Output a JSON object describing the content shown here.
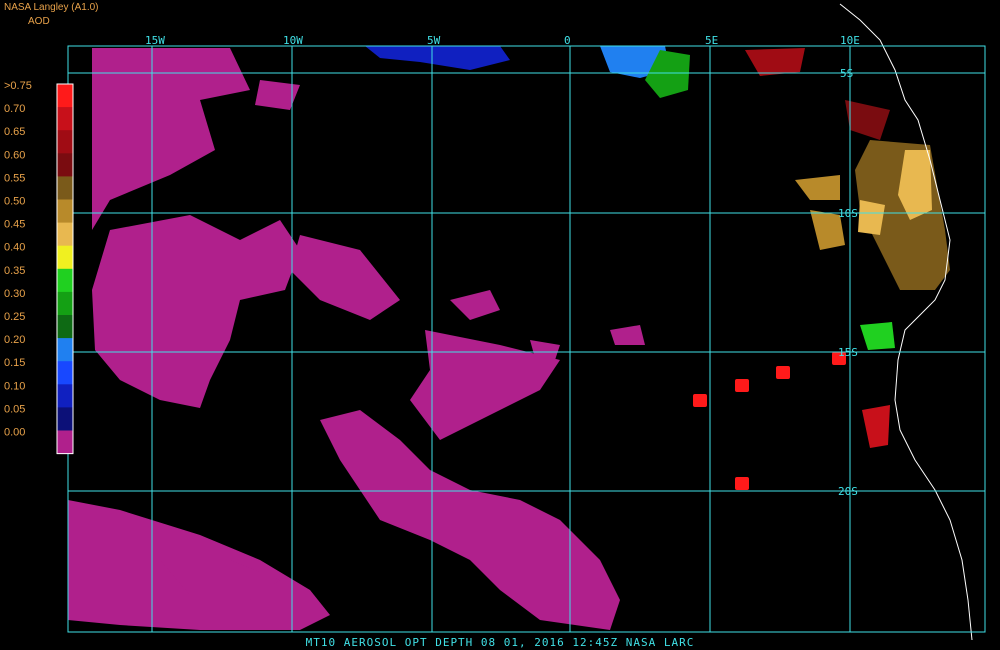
{
  "header": {
    "title": "NASA Langley (A1.0)",
    "unit": "AOD"
  },
  "legend": {
    "labels": [
      ">0.75",
      "0.70",
      "0.65",
      "0.60",
      "0.55",
      "0.50",
      "0.45",
      "0.40",
      "0.35",
      "0.30",
      "0.25",
      "0.20",
      "0.15",
      "0.10",
      "0.05",
      "0.00"
    ],
    "colors": [
      "#ff1a1a",
      "#c8101a",
      "#a00c14",
      "#7a0c10",
      "#7a5a1a",
      "#b88a2a",
      "#e8b850",
      "#f0f020",
      "#20d020",
      "#14a014",
      "#0e6a14",
      "#2080f0",
      "#1848ff",
      "#1020c0",
      "#0c1078",
      "#b0208c"
    ],
    "text_color": "#e8a24a"
  },
  "grid": {
    "color": "#40e0e6",
    "lon_labels": [
      "15W",
      "10W",
      "5W",
      "0",
      "5E",
      "10E"
    ],
    "lat_labels": [
      "5S",
      "10S",
      "15S",
      "20S"
    ]
  },
  "footer": {
    "text": "MT10  AEROSOL OPT DEPTH   08 01, 2016 12:45Z   NASA LARC"
  },
  "colors": {
    "aod_low": "#b0208c",
    "coastline": "#ffffff",
    "background": "#000000"
  }
}
